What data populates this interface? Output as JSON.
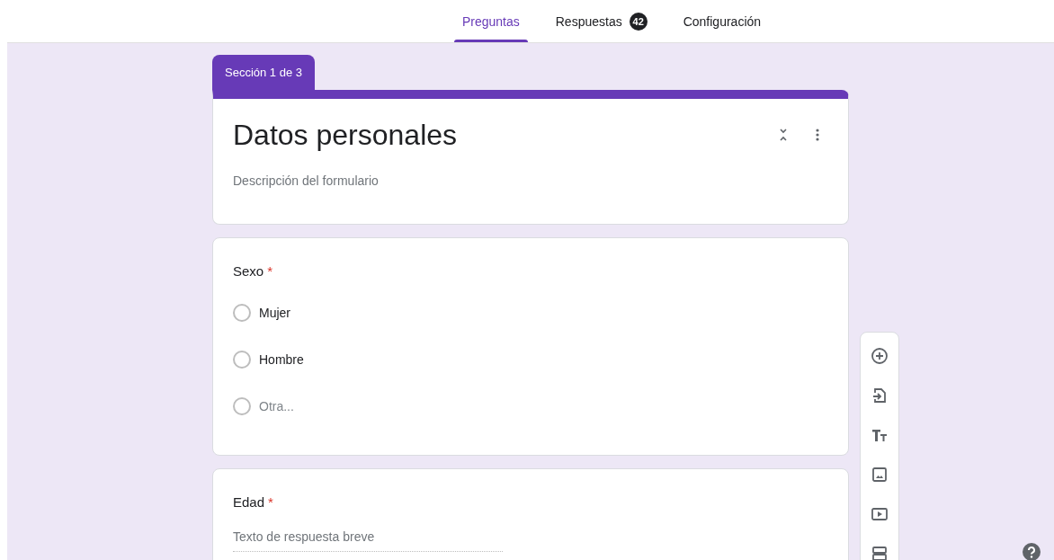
{
  "tabs": [
    {
      "label": "Preguntas",
      "selected": true
    },
    {
      "label": "Respuestas",
      "selected": false,
      "badge": "42"
    },
    {
      "label": "Configuración",
      "selected": false
    }
  ],
  "section": {
    "tab": "Sección 1 de 3",
    "title": "Datos personales",
    "description": "Descripción del formulario"
  },
  "questions": [
    {
      "kind": "choice",
      "title": "Sexo",
      "required_mark": "*",
      "options": [
        {
          "label": "Mujer",
          "kind": "option",
          "selected": false
        },
        {
          "label": "Hombre",
          "kind": "option",
          "selected": false
        },
        {
          "label": "Otra...",
          "kind": "other",
          "selected": false
        }
      ]
    },
    {
      "kind": "short",
      "title": "Edad",
      "required_mark": "*",
      "placeholder": "Texto de respuesta breve"
    }
  ]
}
